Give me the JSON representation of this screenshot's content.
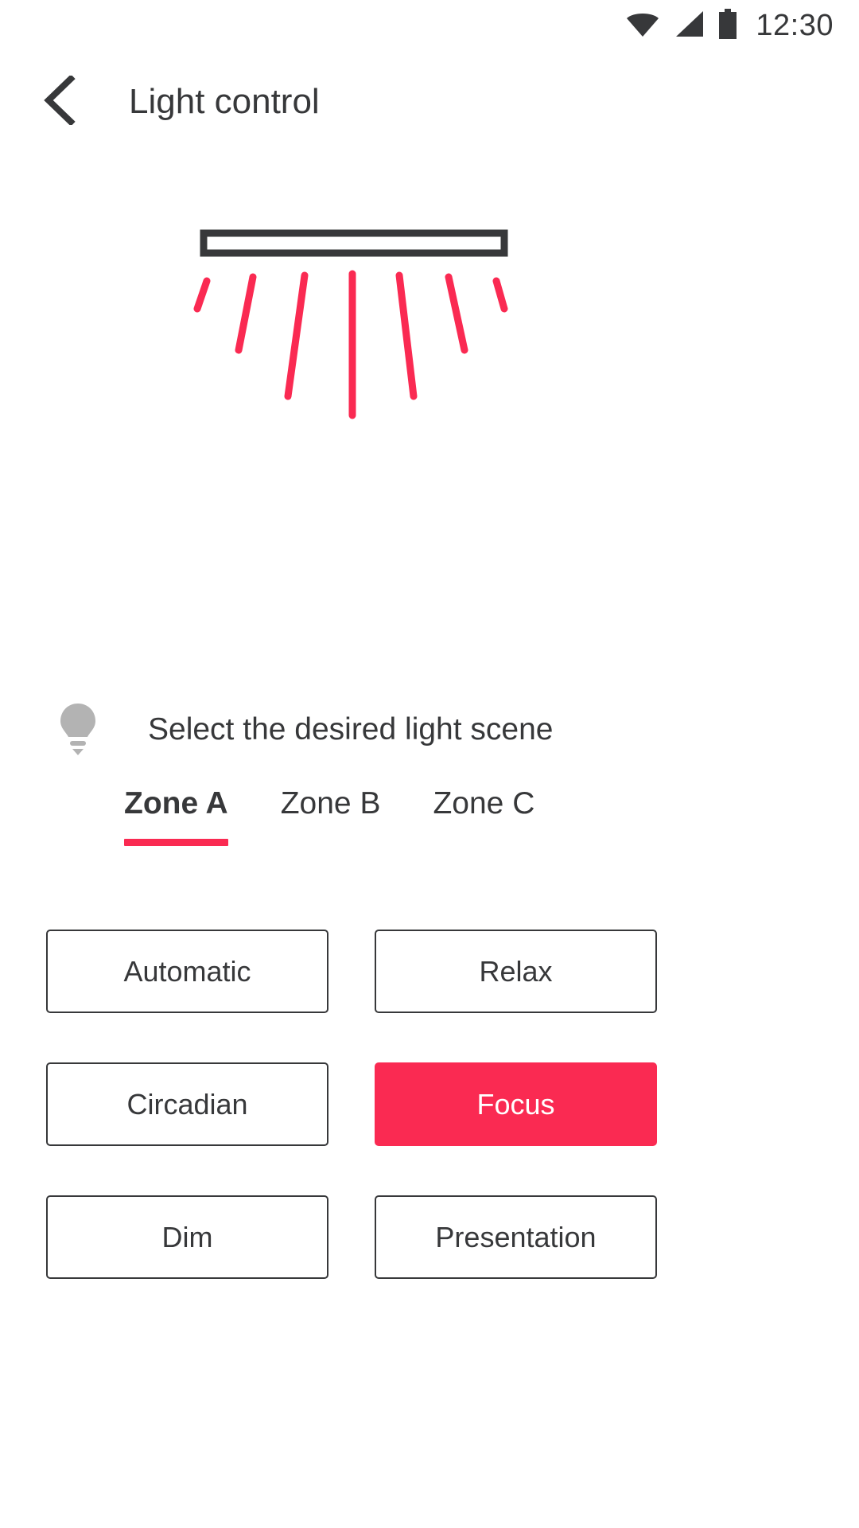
{
  "status_bar": {
    "time": "12:30",
    "icons": [
      "wifi-icon",
      "signal-icon",
      "battery-icon"
    ]
  },
  "app_bar": {
    "back_icon": "chevron-left-icon",
    "title": "Light control"
  },
  "illustration": {
    "name": "ceiling-light-illustration",
    "fixture_color": "#37383a",
    "ray_color": "#fa2a52",
    "ray_count": 7
  },
  "hint": {
    "icon": "lightbulb-icon",
    "text": "Select the desired light scene"
  },
  "tabs": {
    "active_index": 0,
    "items": [
      {
        "label": "Zone A"
      },
      {
        "label": "Zone B"
      },
      {
        "label": "Zone C"
      }
    ]
  },
  "scenes": {
    "selected": "Focus",
    "items": [
      {
        "label": "Automatic",
        "selected": false
      },
      {
        "label": "Relax",
        "selected": false
      },
      {
        "label": "Circadian",
        "selected": false
      },
      {
        "label": "Focus",
        "selected": true
      },
      {
        "label": "Dim",
        "selected": false
      },
      {
        "label": "Presentation",
        "selected": false
      }
    ]
  },
  "colors": {
    "accent": "#fa2a52",
    "ink": "#37383a",
    "muted": "#b3b3b3",
    "background": "#ffffff"
  }
}
